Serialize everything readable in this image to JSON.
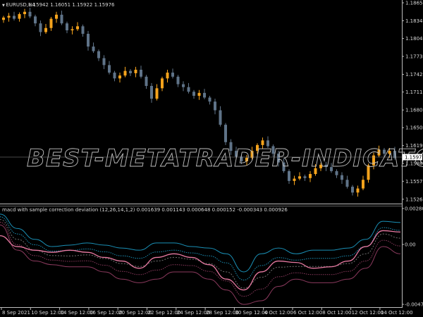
{
  "chart_data": [
    {
      "type": "candlestick",
      "title": "EURUSD,H4",
      "ohlc_header": [
        "1.15942",
        "1.16051",
        "1.15922",
        "1.15976"
      ],
      "current_price": "1.15976",
      "ylim": [
        1.1505,
        1.1868
      ],
      "y_ticks": [
        "1.18655",
        "1.18345",
        "1.18040",
        "1.17730",
        "1.17420",
        "1.17115",
        "1.16805",
        "1.16500",
        "1.16190",
        "1.15880",
        "1.15575",
        "1.15265"
      ],
      "closes": [
        1.184,
        1.1843,
        1.1838,
        1.1846,
        1.185,
        1.1842,
        1.183,
        1.1815,
        1.1822,
        1.1838,
        1.1845,
        1.183,
        1.1818,
        1.182,
        1.1825,
        1.1812,
        1.179,
        1.1782,
        1.177,
        1.1758,
        1.1745,
        1.1735,
        1.174,
        1.1748,
        1.1744,
        1.175,
        1.1738,
        1.1722,
        1.17,
        1.1718,
        1.1735,
        1.1745,
        1.1738,
        1.1725,
        1.172,
        1.1712,
        1.1705,
        1.171,
        1.1702,
        1.1695,
        1.168,
        1.1655,
        1.1625,
        1.161,
        1.16,
        1.1592,
        1.1598,
        1.161,
        1.162,
        1.1628,
        1.1618,
        1.1605,
        1.159,
        1.1575,
        1.1558,
        1.1562,
        1.1566,
        1.1563,
        1.157,
        1.158,
        1.1586,
        1.1582,
        1.1575,
        1.1568,
        1.156,
        1.1548,
        1.1538,
        1.1545,
        1.156,
        1.1585,
        1.1602,
        1.1612,
        1.1605,
        1.161,
        1.15976
      ],
      "colors": {
        "bull": "#f5a31c",
        "bear": "#5f7388",
        "grid": "#3a3a3a",
        "price_line": "#8c8c8c"
      }
    },
    {
      "type": "line",
      "title": "macd with sample correction deviation (12,26,14,1,2) 0.001639 0.001143 0.000648 0.000152 -0.000343 0.000926",
      "ylim": [
        -0.004745,
        0.002807
      ],
      "y_ticks": [
        "0.002807",
        "0.00",
        "-0.004745"
      ],
      "series": [
        {
          "name": "upper",
          "color": "#1a8fb5",
          "values": [
            0.00227,
            0.00119,
            0.00038,
            -0.00016,
            -5e-05,
            0.00011,
            -5e-05,
            -0.00027,
            -0.00043,
            0.00011,
            0.00011,
            -0.00016,
            -0.00027,
            -0.0007,
            -0.00205,
            -0.0007,
            -0.00027,
            -0.0007,
            -0.00043,
            -0.00043,
            -0.00027,
            0.00038,
            0.00173,
            0.00164
          ]
        },
        {
          "name": "main",
          "color": "#e87aa2",
          "values": [
            0.00065,
            -0.00016,
            -0.00043,
            -0.00059,
            -0.00043,
            -0.00059,
            -0.00097,
            -0.00124,
            -0.00178,
            -0.00097,
            -0.0007,
            -0.00097,
            -0.00151,
            -0.00259,
            -0.0034,
            -0.00205,
            -0.00124,
            -0.00135,
            -0.00178,
            -0.00167,
            -0.00124,
            -0.00016,
            0.00103,
            0.000926
          ]
        },
        {
          "name": "lower",
          "color": "#8c3a5e",
          "values": [
            0.00146,
            -0.00043,
            -0.00124,
            -0.00151,
            -0.00167,
            -0.00167,
            -0.00205,
            -0.00259,
            -0.00286,
            -0.00259,
            -0.00205,
            -0.00205,
            -0.00259,
            -0.0034,
            -0.00448,
            -0.00421,
            -0.00313,
            -0.00259,
            -0.00286,
            -0.00286,
            -0.00259,
            -0.00178,
            -0.00016,
            -0.0007
          ]
        }
      ]
    }
  ],
  "x_labels": [
    "8 Sep 2021",
    "10 Sep 12:00",
    "14 Sep 12:00",
    "16 Sep 12:00",
    "20 Sep 12:00",
    "22 Sep 12:00",
    "24 Sep 12:00",
    "28 Sep 12:00",
    "30 Sep 12:00",
    "4 Oct 12:00",
    "6 Oct 12:00",
    "8 Oct 12:00",
    "12 Oct 12:00",
    "14 Oct 12:00"
  ],
  "watermark": "BEST-METATRADER-INDICATORS.COM"
}
